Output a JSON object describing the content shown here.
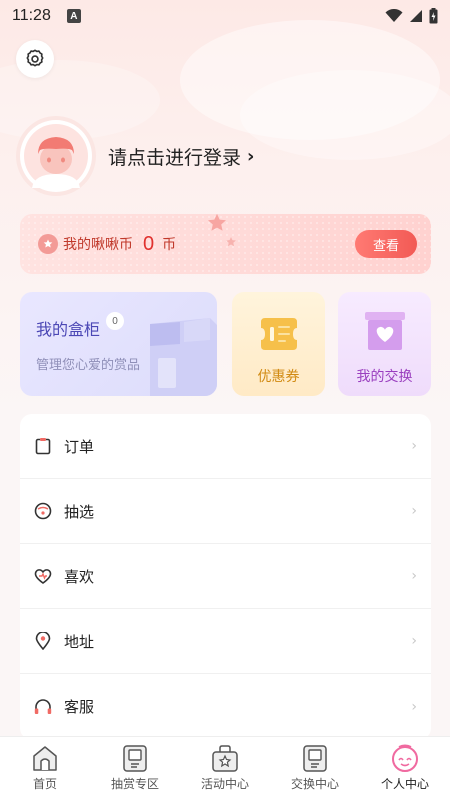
{
  "status": {
    "time": "11:28",
    "notification": "A"
  },
  "profile": {
    "login_prompt": "请点击进行登录"
  },
  "coins": {
    "label": "我的啾啾币",
    "value": "0",
    "unit": "币",
    "view_button": "查看"
  },
  "box_cabinet": {
    "title": "我的盒柜",
    "count": "0",
    "subtitle": "管理您心爱的赏品"
  },
  "coupon": {
    "label": "优惠券"
  },
  "exchange": {
    "label": "我的交换"
  },
  "menu": {
    "items": [
      {
        "label": "订单",
        "icon": "order-icon"
      },
      {
        "label": "抽选",
        "icon": "draw-icon"
      },
      {
        "label": "喜欢",
        "icon": "heart-icon"
      },
      {
        "label": "地址",
        "icon": "location-icon"
      },
      {
        "label": "客服",
        "icon": "headset-icon"
      }
    ]
  },
  "tabs": [
    {
      "label": "首页",
      "icon": "home-icon"
    },
    {
      "label": "抽赏专区",
      "icon": "prize-zone-icon"
    },
    {
      "label": "活动中心",
      "icon": "activity-icon"
    },
    {
      "label": "交换中心",
      "icon": "exchange-icon"
    },
    {
      "label": "个人中心",
      "icon": "profile-icon",
      "active": true
    }
  ],
  "colors": {
    "accent": "#f25a55",
    "coin_text": "#e0322f",
    "box_title": "#4b47b5",
    "coupon": "#d18a12",
    "exchange": "#9a3fbf",
    "active_tab": "#f06aa0"
  }
}
